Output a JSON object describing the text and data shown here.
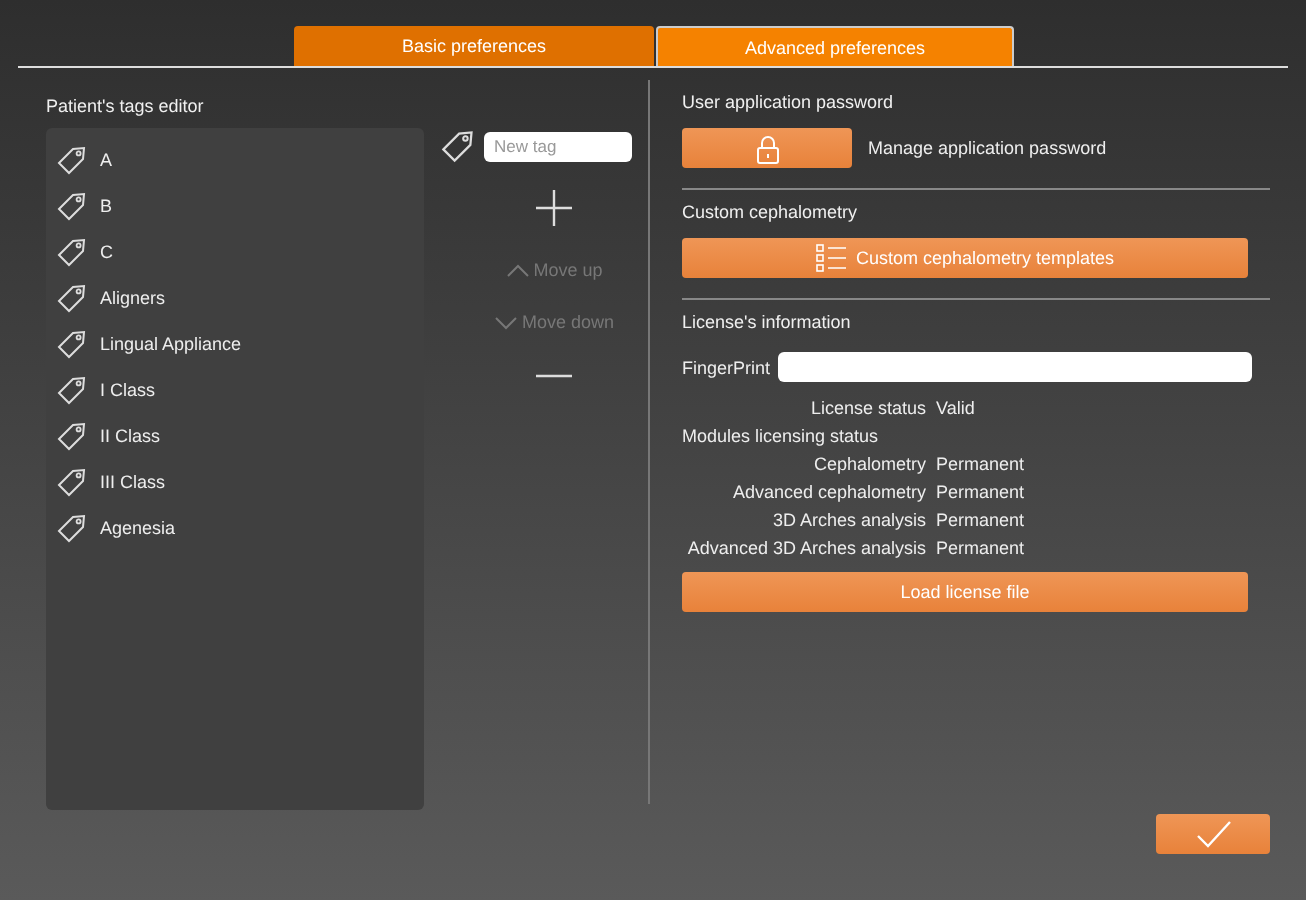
{
  "tabs": [
    {
      "label": "Basic preferences",
      "selected": false
    },
    {
      "label": "Advanced preferences",
      "selected": true
    }
  ],
  "tags_editor": {
    "title": "Patient's tags editor",
    "tags": [
      "A",
      "B",
      "C",
      "Aligners",
      "Lingual Appliance",
      "I Class",
      "II Class",
      "III Class",
      "Agenesia"
    ],
    "new_tag": {
      "placeholder": "New tag"
    },
    "move_up": {
      "label": "Move up",
      "disabled": true
    },
    "move_down": {
      "label": "Move down",
      "disabled": true
    }
  },
  "password": {
    "title": "User application password",
    "label": "Manage application password"
  },
  "cephalometry": {
    "title": "Custom cephalometry",
    "button": "Custom cephalometry templates"
  },
  "license": {
    "title": "License's information",
    "fingerprint_label": "FingerPrint",
    "status": {
      "label": "License status",
      "value": "Valid"
    },
    "modules_title": "Modules licensing status",
    "modules": [
      {
        "name": "Cephalometry",
        "value": "Permanent"
      },
      {
        "name": "Advanced cephalometry",
        "value": "Permanent"
      },
      {
        "name": "3D Arches analysis",
        "value": "Permanent"
      },
      {
        "name": "Advanced 3D Arches analysis",
        "value": "Permanent"
      }
    ],
    "load_button": "Load license file"
  }
}
